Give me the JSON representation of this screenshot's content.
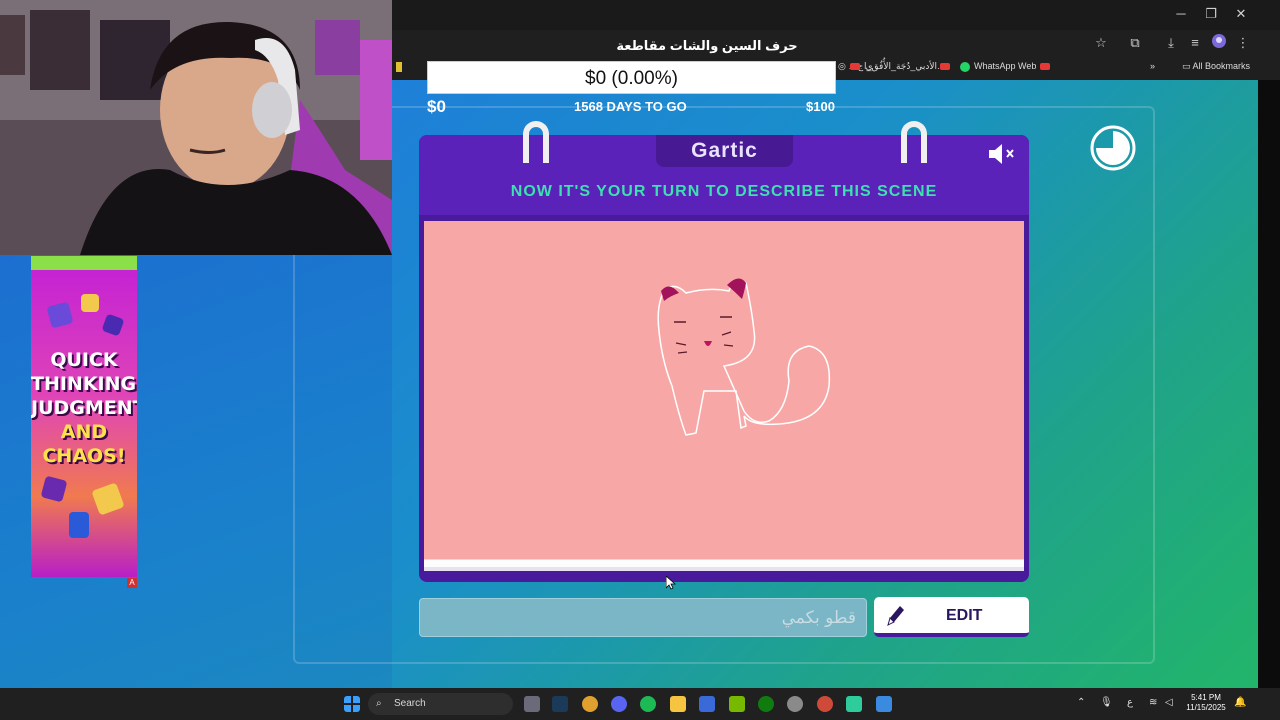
{
  "browser": {
    "page_title": "حرف السين والشات مقاطعة",
    "bookmarks": [
      {
        "label": "…ى ج"
      },
      {
        "label": "الأدبي_دُجَة_الأُفُق_ا…"
      },
      {
        "label": "WhatsApp Web"
      },
      {
        "label": "All Bookmarks"
      }
    ]
  },
  "progress": {
    "amount": "$0 (0.00%)",
    "start": "$0",
    "days": "1568 DAYS TO GO",
    "goal": "$100",
    "fraction": 0.0
  },
  "game": {
    "logo": "Gartic",
    "headline": "NOW IT'S YOUR TURN TO DESCRIBE THIS SCENE",
    "input_value": "قطو بكمي",
    "edit_label": "EDIT",
    "colors": {
      "book_purple": "#4a1a9c",
      "headline_teal": "#3ee0b0",
      "canvas_pink": "#f7a8a6"
    }
  },
  "ad": {
    "lines": [
      "QUICK",
      "THINKING,",
      "JUDGMENT",
      "AND",
      "CHAOS!"
    ],
    "badge": "A"
  },
  "taskbar": {
    "search_label": "Search",
    "time": "5:41 PM",
    "date": "11/15/2025",
    "lang": "ع"
  }
}
